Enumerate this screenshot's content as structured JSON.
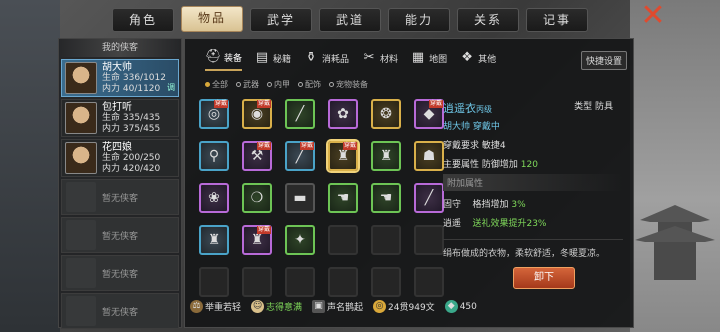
{
  "tabs": [
    "角色",
    "物品",
    "武学",
    "武道",
    "能力",
    "关系",
    "记事"
  ],
  "close_icon": "close-x-icon",
  "side": {
    "title": "我的侠客",
    "heroes": [
      {
        "name": "胡大帅",
        "hp": "生命 336/1012",
        "mp": "内力 40/1120",
        "tag": "调"
      },
      {
        "name": "包打听",
        "hp": "生命 335/435",
        "mp": "内力 375/455"
      },
      {
        "name": "花四娘",
        "hp": "生命 200/250",
        "mp": "内力 420/420"
      }
    ],
    "empty": [
      "暂无侠客",
      "暂无侠客",
      "暂无侠客",
      "暂无侠客"
    ]
  },
  "subtabs": [
    {
      "label": "装备",
      "icon": "armor-icon"
    },
    {
      "label": "秘籍",
      "icon": "book-icon"
    },
    {
      "label": "消耗品",
      "icon": "potion-icon"
    },
    {
      "label": "材料",
      "icon": "material-icon"
    },
    {
      "label": "地图",
      "icon": "map-icon"
    },
    {
      "label": "其他",
      "icon": "other-icon"
    }
  ],
  "quick_label": "快捷设置",
  "filters": [
    "全部",
    "武器",
    "内甲",
    "配饰",
    "宠物装备"
  ],
  "equip_tag": "穿戴",
  "detail": {
    "name": "逍遥衣",
    "grade": "丙级",
    "type_label": "类型",
    "type": "防具",
    "owner": "胡大帅 穿戴中",
    "req_label": "穿戴要求",
    "req": "敏捷4",
    "attr_label": "主要属性",
    "attr": "防御增加",
    "attr_val": "120",
    "extra_label": "附加属性",
    "fix1_label": "固守",
    "fix1": "格挡增加",
    "fix1_val": "3%",
    "fix2_label": "逍遥",
    "fix2": "送礼效果提升23%",
    "desc": "绢布做成的衣物，柔软舒适，冬暖夏凉。"
  },
  "unequip_label": "卸下",
  "status": [
    {
      "icon": "weight-icon",
      "text": "举重若轻"
    },
    {
      "icon": "face-icon",
      "text": "志得意满"
    },
    {
      "icon": "fame-icon",
      "text": "声名鹊起"
    },
    {
      "icon": "coin-icon",
      "text": "24贯949文"
    },
    {
      "icon": "gem-icon",
      "text": "450"
    }
  ]
}
